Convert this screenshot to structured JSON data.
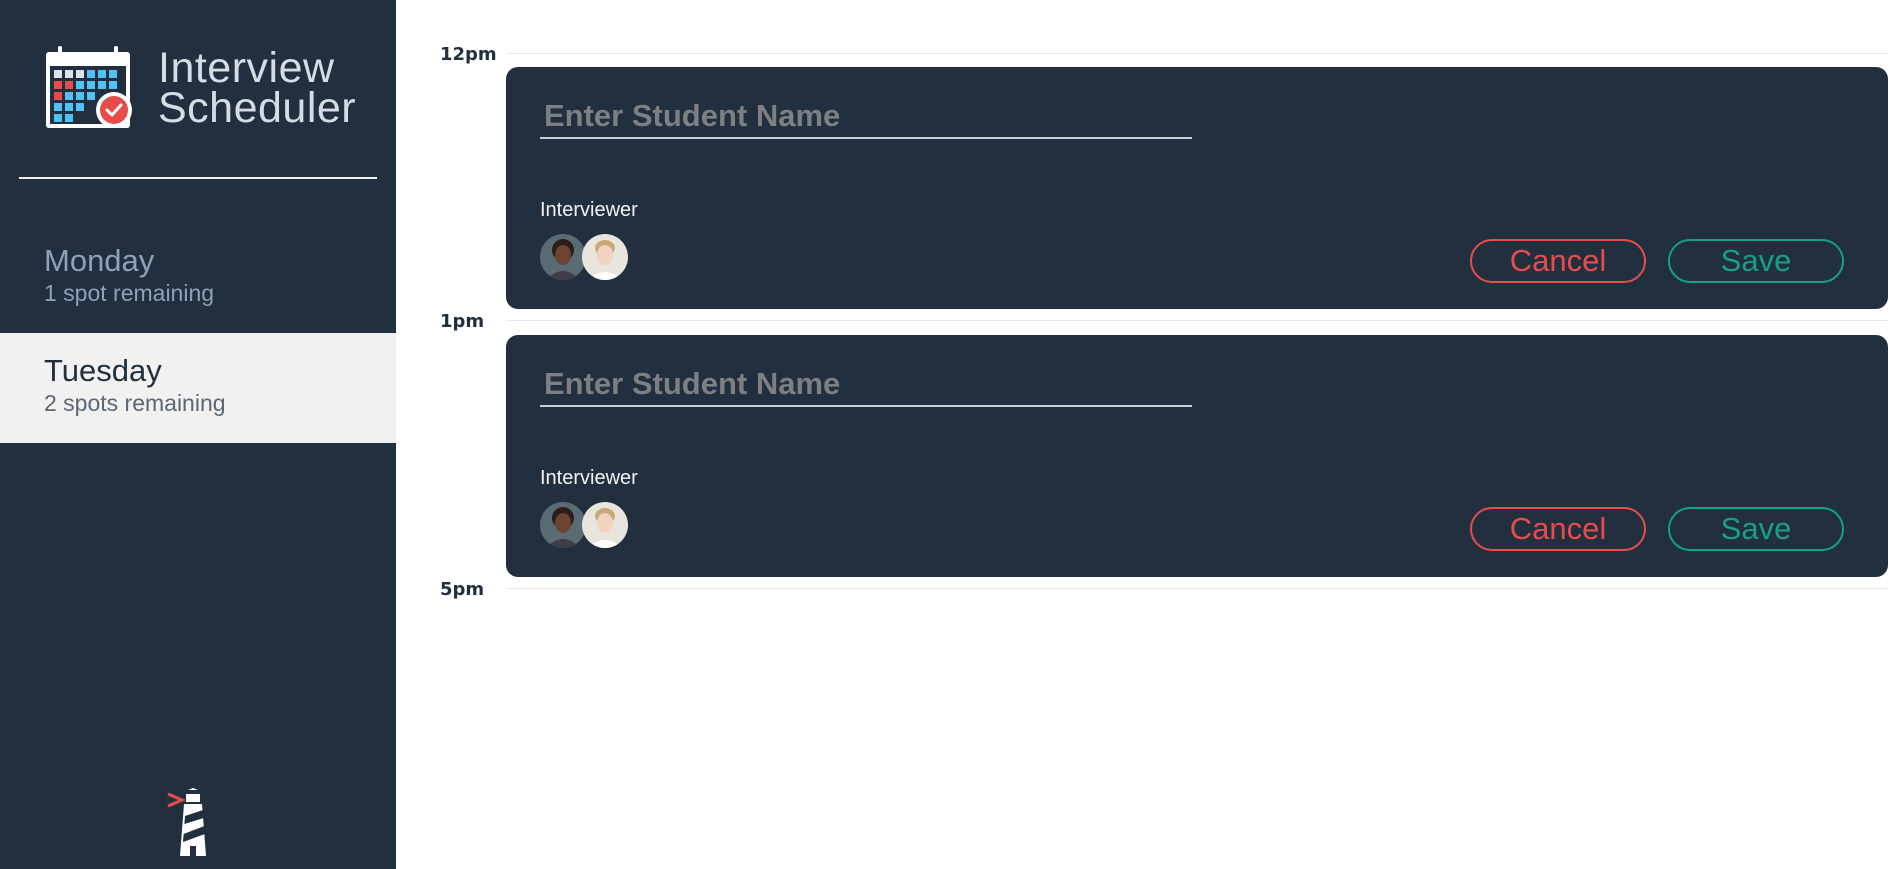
{
  "app": {
    "title_line1": "Interview",
    "title_line2": "Scheduler",
    "logo_icon": "calendar-check-icon",
    "footer_icon": "lighthouse-icon"
  },
  "sidebar": {
    "days": [
      {
        "name": "Monday",
        "spots": "1 spot remaining",
        "selected": false
      },
      {
        "name": "Tuesday",
        "spots": "2 spots remaining",
        "selected": true
      }
    ]
  },
  "schedule": {
    "time_labels": [
      "12pm",
      "1pm",
      "5pm"
    ],
    "appointments": [
      {
        "student_placeholder": "Enter Student Name",
        "student_value": "",
        "interviewer_label": "Interviewer",
        "cancel_label": "Cancel",
        "save_label": "Save"
      },
      {
        "student_placeholder": "Enter Student Name",
        "student_value": "",
        "interviewer_label": "Interviewer",
        "cancel_label": "Cancel",
        "save_label": "Save"
      }
    ]
  },
  "colors": {
    "sidebar_bg": "#222f3e",
    "selected_day_bg": "#f1f1f1",
    "danger": "#e74c4c",
    "success": "#16a085"
  }
}
